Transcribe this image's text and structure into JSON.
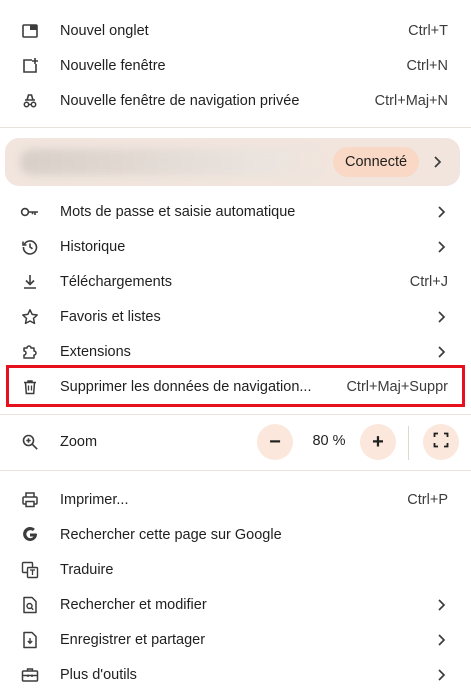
{
  "section1": [
    {
      "label": "Nouvel onglet",
      "shortcut": "Ctrl+T"
    },
    {
      "label": "Nouvelle fenêtre",
      "shortcut": "Ctrl+N"
    },
    {
      "label": "Nouvelle fenêtre de navigation privée",
      "shortcut": "Ctrl+Maj+N"
    }
  ],
  "profile": {
    "status": "Connecté"
  },
  "section2": [
    {
      "label": "Mots de passe et saisie automatique"
    },
    {
      "label": "Historique"
    },
    {
      "label": "Téléchargements",
      "shortcut": "Ctrl+J"
    },
    {
      "label": "Favoris et listes"
    },
    {
      "label": "Extensions"
    },
    {
      "label": "Supprimer les données de navigation...",
      "shortcut": "Ctrl+Maj+Suppr"
    }
  ],
  "zoom": {
    "label": "Zoom",
    "value": "80 %",
    "minus": "−",
    "plus": "+"
  },
  "section3": [
    {
      "label": "Imprimer...",
      "shortcut": "Ctrl+P"
    },
    {
      "label": "Rechercher cette page sur Google"
    },
    {
      "label": "Traduire"
    },
    {
      "label": "Rechercher et modifier"
    },
    {
      "label": "Enregistrer et partager"
    },
    {
      "label": "Plus d'outils"
    }
  ],
  "colors": {
    "highlight": "#e8101c",
    "profile_bg": "#f1e5de",
    "badge_bg": "#f9d8c5",
    "zoom_btn_bg": "#fbe7dc"
  }
}
